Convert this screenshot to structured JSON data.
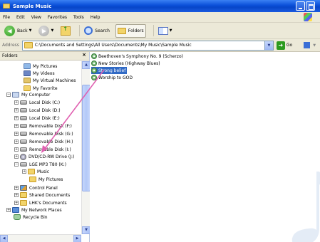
{
  "window": {
    "title": "Sample Music"
  },
  "menu": {
    "file": "File",
    "edit": "Edit",
    "view": "View",
    "favorites": "Favorites",
    "tools": "Tools",
    "help": "Help"
  },
  "toolbar": {
    "back": "Back",
    "search": "Search",
    "folders": "Folders"
  },
  "address": {
    "label": "Address",
    "path": "C:\\Documents and Settings\\All Users\\Documents\\My Music\\Sample Music",
    "go": "Go"
  },
  "folders_pane": {
    "header": "Folders",
    "items": [
      {
        "label": "My Pictures",
        "icon": "pictures-icon"
      },
      {
        "label": "My Videos",
        "icon": "videos-icon"
      },
      {
        "label": "My Virtual Machines",
        "icon": "vm-icon"
      },
      {
        "label": "My Favorite",
        "icon": "folder-icon"
      },
      {
        "label": "My Computer",
        "icon": "computer-icon"
      },
      {
        "label": "Local Disk (C:)",
        "icon": "drive-icon"
      },
      {
        "label": "Local Disk (D:)",
        "icon": "drive-icon"
      },
      {
        "label": "Local Disk (E:)",
        "icon": "drive-icon"
      },
      {
        "label": "Removable Disk (F:)",
        "icon": "drive-icon"
      },
      {
        "label": "Removable Disk (G:)",
        "icon": "drive-icon"
      },
      {
        "label": "Removable Disk (H:)",
        "icon": "drive-icon"
      },
      {
        "label": "Removable Disk (I:)",
        "icon": "drive-icon"
      },
      {
        "label": "DVD/CD-RW Drive (J:)",
        "icon": "dvd-icon"
      },
      {
        "label": "LGE MP3 T80 (K:)",
        "icon": "drive-icon"
      },
      {
        "label": "Music",
        "icon": "folder-icon"
      },
      {
        "label": "My Pictures",
        "icon": "folder-icon"
      },
      {
        "label": "Control Panel",
        "icon": "control-panel-icon"
      },
      {
        "label": "Shared Documents",
        "icon": "folder-icon"
      },
      {
        "label": "LHK's Documents",
        "icon": "folder-icon"
      },
      {
        "label": "My Network Places",
        "icon": "network-icon"
      },
      {
        "label": "Recycle Bin",
        "icon": "recycle-bin-icon"
      }
    ]
  },
  "files": [
    {
      "name": "Beethoven's Symphony No. 9 (Scherzo)",
      "selected": false
    },
    {
      "name": "New Stories (Highway Blues)",
      "selected": false
    },
    {
      "name": "Strong belief",
      "selected": true
    },
    {
      "name": "Worship to GOD",
      "selected": false
    }
  ],
  "colors": {
    "title_bar": "#0a4fd8",
    "selection": "#316ac5",
    "drag_arrow": "#e060b0"
  }
}
